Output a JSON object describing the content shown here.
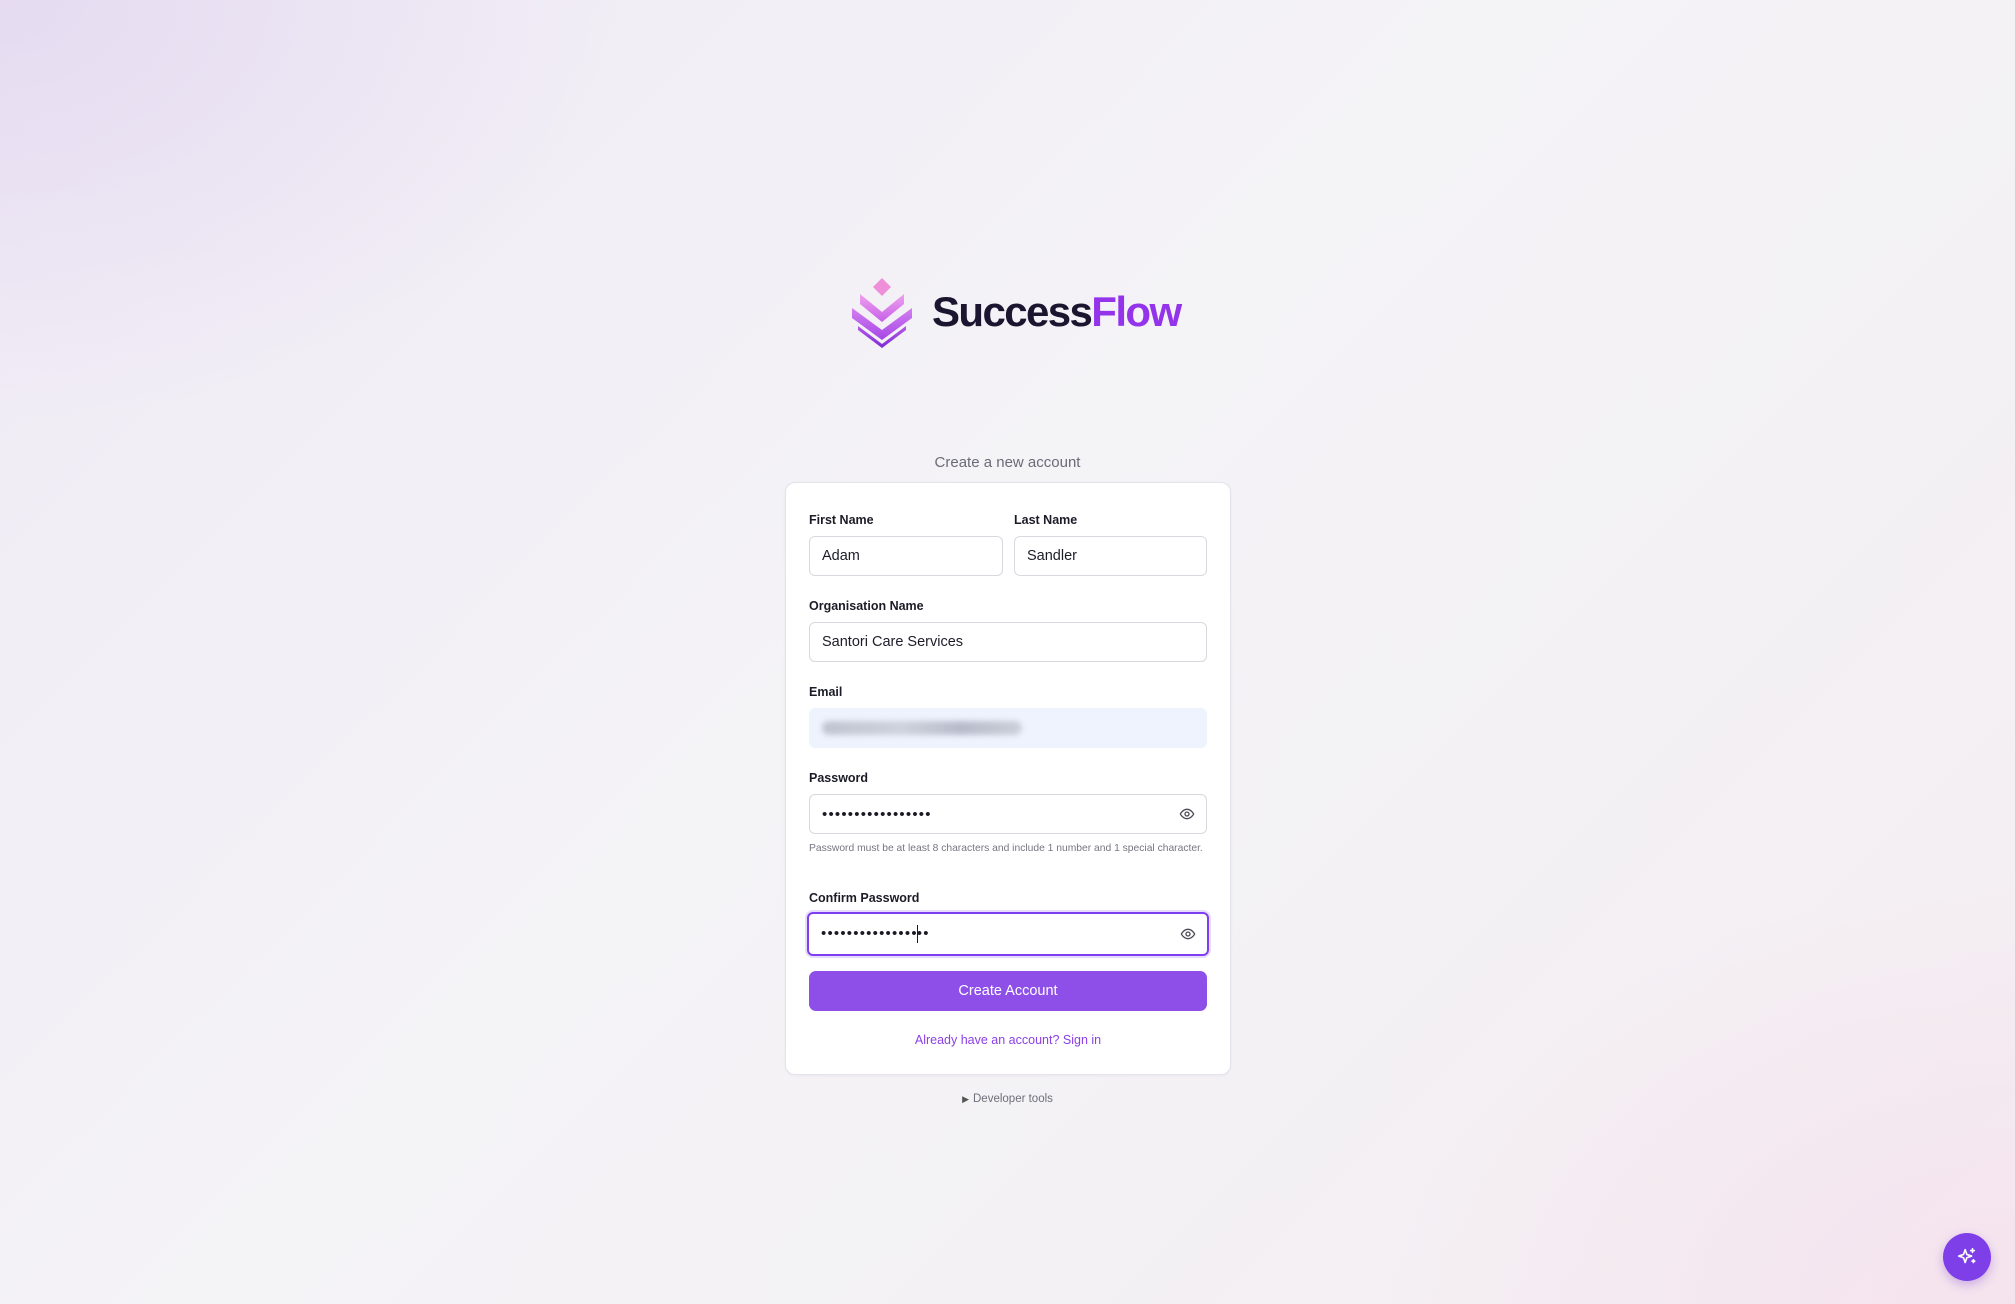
{
  "brand": {
    "name_part1": "Success",
    "name_part2": "Flow",
    "accent_color": "#9333ea",
    "logo_icon": "layered-chevron-diamond-logo"
  },
  "page": {
    "subtitle": "Create a new account"
  },
  "form": {
    "first_name": {
      "label": "First Name",
      "value": "Adam"
    },
    "last_name": {
      "label": "Last Name",
      "value": "Sandler"
    },
    "organisation": {
      "label": "Organisation Name",
      "value": "Santori Care Services"
    },
    "email": {
      "label": "Email",
      "value": ""
    },
    "password": {
      "label": "Password",
      "value_masked": "•••••••••••••••••",
      "hint": "Password must be at least 8 characters and include 1 number and 1 special character.",
      "toggle_icon": "eye-icon"
    },
    "confirm_password": {
      "label": "Confirm Password",
      "value_masked_before_caret": "•••••••••••••••",
      "value_masked_after_caret": "••",
      "toggle_icon": "eye-icon"
    },
    "submit_label": "Create Account",
    "signin_link": "Already have an account? Sign in"
  },
  "footer": {
    "devtools_label": "Developer tools",
    "devtools_marker": "▶"
  },
  "fab": {
    "icon": "sparkles-icon",
    "color": "#7f3fe8"
  },
  "colors": {
    "primary_button": "#8d4fe8",
    "focus_ring": "#7e3ff0",
    "link": "#8b3fe6"
  }
}
